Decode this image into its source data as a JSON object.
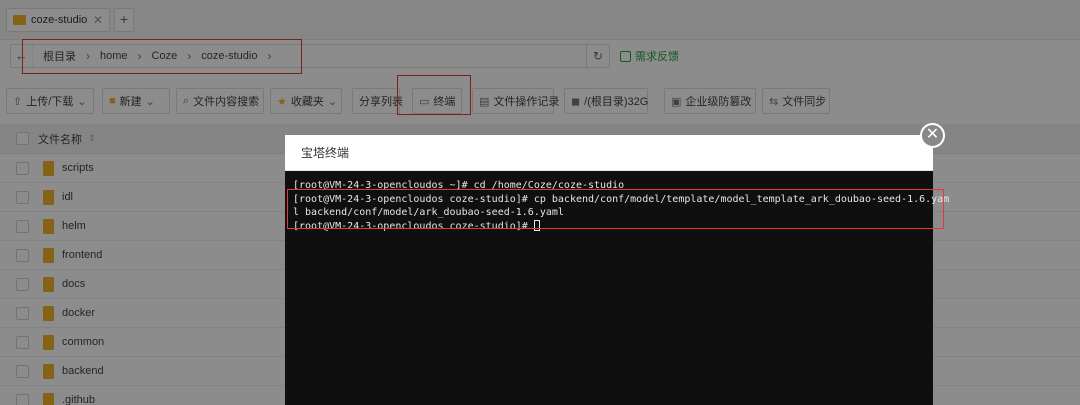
{
  "tab": {
    "label": "coze-studio",
    "close": "✕",
    "new": "+"
  },
  "path": {
    "back": "←",
    "crumbs": [
      "根目录",
      "home",
      "Coze",
      "coze-studio"
    ],
    "separator": "›",
    "refresh": "↻",
    "feedback": "需求反馈"
  },
  "toolbar": {
    "upload": "上传/下载",
    "new": "新建",
    "search": "文件内容搜索",
    "favorites": "收藏夹",
    "share": "分享列表",
    "terminal": "终端",
    "oplog": "文件操作记录",
    "disk": "/(根目录)32G",
    "tamper": "企业级防篡改",
    "sync": "文件同步"
  },
  "table": {
    "col_name": "文件名称",
    "files": [
      "scripts",
      "idl",
      "helm",
      "frontend",
      "docs",
      "docker",
      "common",
      "backend",
      ".github"
    ]
  },
  "terminal": {
    "title": "宝塔终端",
    "lines": [
      "[root@VM-24-3-opencloudos ~]# cd /home/Coze/coze-studio",
      "[root@VM-24-3-opencloudos coze-studio]# cp backend/conf/model/template/model_template_ark_doubao-seed-1.6.yam",
      "l backend/conf/model/ark_doubao-seed-1.6.yaml",
      "[root@VM-24-3-opencloudos coze-studio]# "
    ],
    "close": "✕"
  },
  "colors": {
    "accent": "#20a53a",
    "highlight": "#e53935",
    "folder": "#f0b429"
  }
}
